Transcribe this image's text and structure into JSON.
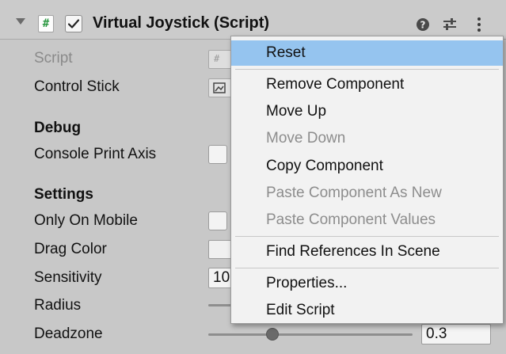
{
  "header": {
    "component_title": "Virtual Joystick (Script)",
    "script_icon_glyph": "#",
    "enabled": true,
    "icons": [
      "chevron-down-icon",
      "script-icon",
      "checkbox-icon",
      "help-icon",
      "presets-icon",
      "more-vertical-icon"
    ]
  },
  "properties": {
    "script_label": "Script",
    "control_stick_label": "Control Stick",
    "debug_header": "Debug",
    "console_print_axis_label": "Console Print Axis",
    "settings_header": "Settings",
    "only_on_mobile_label": "Only On Mobile",
    "drag_color_label": "Drag Color",
    "sensitivity_label": "Sensitivity",
    "sensitivity_value": "10",
    "radius_label": "Radius",
    "deadzone_label": "Deadzone",
    "deadzone_value": "0.3"
  },
  "context_menu": {
    "items": [
      {
        "label": "Reset",
        "enabled": true,
        "highlighted": true
      },
      {
        "label": "Remove Component",
        "enabled": true
      },
      {
        "label": "Move Up",
        "enabled": true
      },
      {
        "label": "Move Down",
        "enabled": false
      },
      {
        "label": "Copy Component",
        "enabled": true
      },
      {
        "label": "Paste Component As New",
        "enabled": false
      },
      {
        "label": "Paste Component Values",
        "enabled": false
      },
      {
        "label": "Find References In Scene",
        "enabled": true
      },
      {
        "label": "Properties...",
        "enabled": true
      },
      {
        "label": "Edit Script",
        "enabled": true
      }
    ]
  },
  "colors": {
    "panel_bg": "#c8c8c8",
    "menu_bg": "#f2f2f2",
    "menu_highlight": "#95c4ef",
    "disabled_text": "#8d8d8d",
    "script_icon_green": "#2f9a45"
  }
}
